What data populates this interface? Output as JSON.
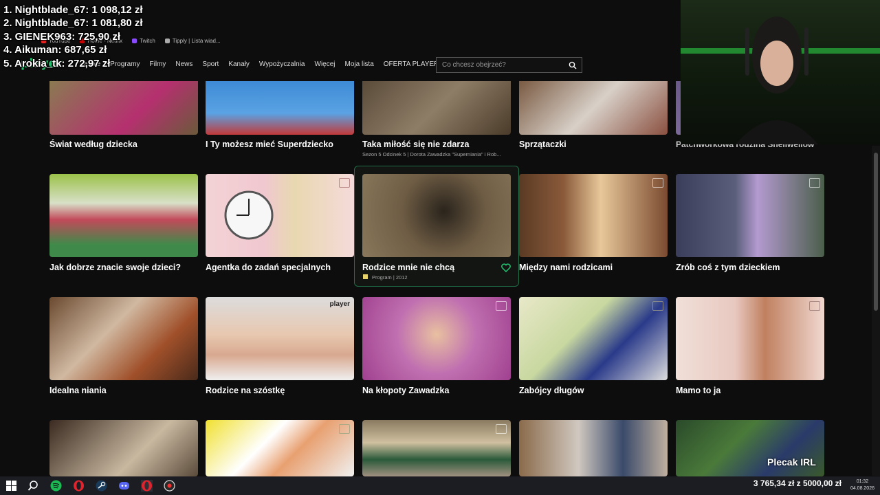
{
  "donors": [
    "1. Nightblade_67: 1 098,12 zł",
    "2. Nightblade_67: 1 081,80 zł",
    "3. GIENEK963: 725,90 zł",
    "4. Aikuman: 687,65 zł",
    "5. Arokia_tk: 272,97 zł"
  ],
  "bookmarks": [
    "YouTube",
    "Home - Netflix",
    "Twitch",
    "Tipply | Lista wiad..."
  ],
  "nav": {
    "logo": "player",
    "links": [
      "Seriale",
      "Programy",
      "Filmy",
      "News",
      "Sport",
      "Kanały",
      "Wypożyczalnia",
      "Więcej",
      "Moja lista",
      "OFERTA PLAYER"
    ],
    "search_placeholder": "Co chcesz obejrzeć?"
  },
  "tiles": {
    "r1": [
      "Świat według dziecka",
      "I Ty możesz mieć Superdziecko",
      "Taka miłość się nie zdarza",
      "Sprzątaczki",
      "Patchworkowa rodzina Shellwellów"
    ],
    "r1_sub": "Sezon 5 Odcinek 5 | Dorota Zawadzka \"Superniania\" i Rob...",
    "r2": [
      "Jak dobrze znacie swoje dzieci?",
      "Agentka do zadań specjalnych",
      "Rodzice mnie nie chcą",
      "Między nami rodzicami",
      "Zrób coś z tym dzieckiem"
    ],
    "r2_sub": "Program | 2012",
    "r3": [
      "Idealna niania",
      "Rodzice na szóstkę",
      "Na kłopoty Zawadzka",
      "Zabójcy długów",
      "Mamo to ja"
    ],
    "player_tag": "player"
  },
  "overlay": {
    "plecak": "Plecak IRL",
    "goal": "3 765,34 zł z 5000,00 zł",
    "time": "01:32",
    "date": "04.08.2026"
  },
  "colors": {
    "accent": "#23c36f",
    "bg": "#0d0d0d"
  }
}
